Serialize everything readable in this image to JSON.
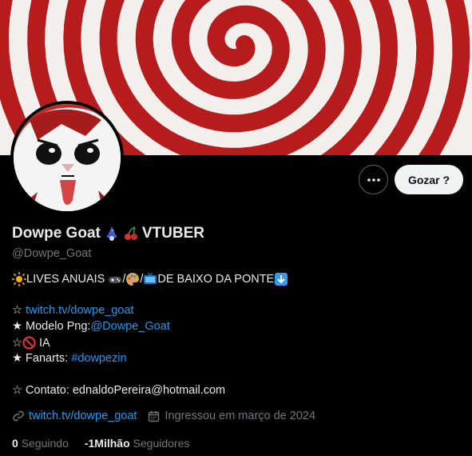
{
  "profile": {
    "display_name": "Dowpe Goat",
    "display_tag": "VTUBER",
    "handle": "@Dowpe_Goat",
    "follow_label": "Gozar ?"
  },
  "bio": {
    "line1_text": "LIVES ANUAIS",
    "line1_sep1": "/",
    "line1_sep2": "/",
    "line1_end": " DE BAIXO DA PONTE",
    "line2_prefix": "☆ ",
    "line2_link": "twitch.tv/dowpe_goat",
    "line3_prefix": "★ Modelo Png:",
    "line3_link": "@Dowpe_Goat",
    "line4_prefix": "☆",
    "line4_text": " IA",
    "line5_prefix": "★ Fanarts: ",
    "line5_link": "#dowpezin",
    "line6_text": "☆ Contato: ednaldoPereira@hotmail.com"
  },
  "meta": {
    "website": "twitch.tv/dowpe_goat",
    "joined": "Ingressou em março de 2024"
  },
  "stats": {
    "following_count": "0",
    "following_label": "Seguindo",
    "followers_count": "-1Milhão",
    "followers_label": "Seguidores"
  },
  "colors": {
    "accent": "#1d9bf0",
    "banner_red": "#b71c1c",
    "muted": "#71767b"
  },
  "icons": [
    "more-icon",
    "link-icon",
    "calendar-icon",
    "wizard-emoji",
    "cherries-emoji",
    "sun-emoji",
    "gamepad-emoji",
    "palette-emoji",
    "tv-emoji",
    "down-arrow-emoji",
    "prohibited-emoji"
  ]
}
